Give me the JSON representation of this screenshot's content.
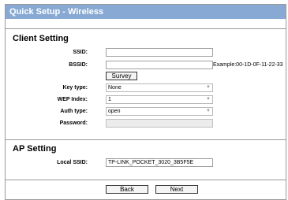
{
  "header": {
    "title": "Quick Setup - Wireless"
  },
  "client": {
    "title": "Client Setting",
    "ssid_label": "SSID:",
    "ssid_value": "",
    "bssid_label": "BSSID:",
    "bssid_value": "",
    "bssid_hint": "Example:00-1D-0F-11-22-33",
    "survey_label": "Survey",
    "key_type_label": "Key type:",
    "key_type_value": "None",
    "wep_index_label": "WEP Index:",
    "wep_index_value": "1",
    "auth_type_label": "Auth type:",
    "auth_type_value": "open",
    "password_label": "Password:",
    "password_value": ""
  },
  "ap": {
    "title": "AP Setting",
    "local_ssid_label": "Local SSID:",
    "local_ssid_value": "TP-LINK_POCKET_3020_3B5F5E"
  },
  "footer": {
    "back_label": "Back",
    "next_label": "Next"
  },
  "colors": {
    "title_bar": "#87a9d3"
  }
}
